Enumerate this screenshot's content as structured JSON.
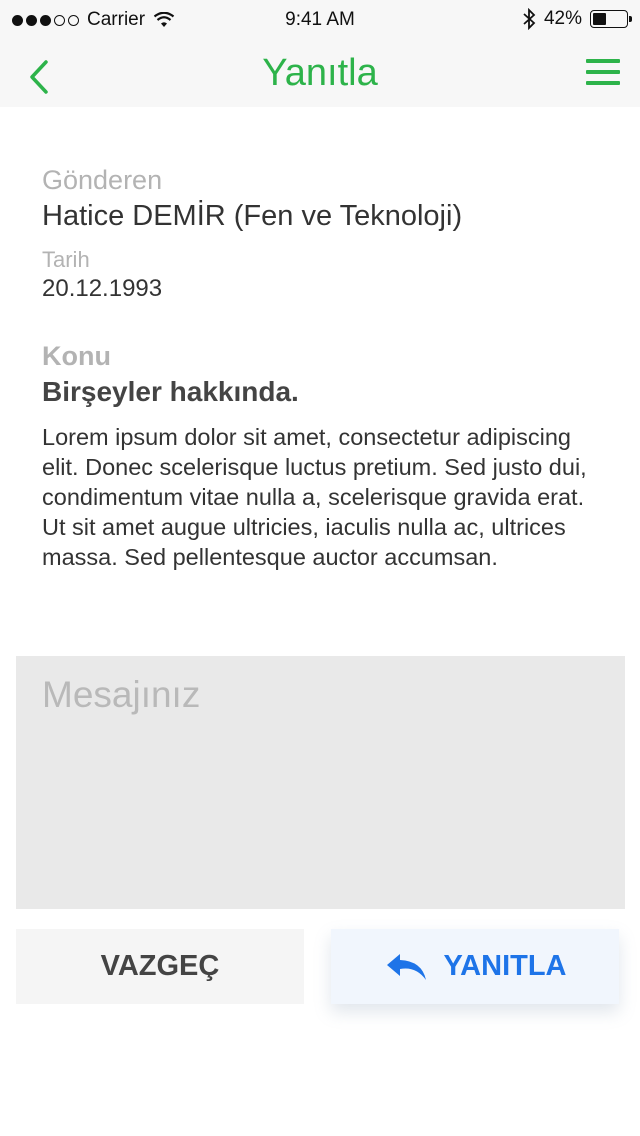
{
  "status_bar": {
    "carrier": "Carrier",
    "time": "9:41 AM",
    "battery": "42%",
    "battery_level": 0.42
  },
  "nav": {
    "title": "Yanıtla",
    "back_icon": "chevron-left-icon",
    "menu_icon": "hamburger-menu-icon"
  },
  "message": {
    "sender_label": "Gönderen",
    "sender": "Hatice DEMİR (Fen ve Teknoloji)",
    "date_label": "Tarih",
    "date": "20.12.1993",
    "subject_label": "Konu",
    "subject": "Birşeyler hakkında.",
    "body": "Lorem ipsum dolor sit amet, consectetur adipiscing elit. Donec scelerisque luctus pretium. Sed justo dui, condimentum vitae nulla a, scelerisque gravida erat. Ut sit amet augue ultricies, iaculis nulla ac, ultrices massa. Sed pellentesque auctor accumsan."
  },
  "reply": {
    "placeholder": "Mesajınız",
    "value": ""
  },
  "actions": {
    "cancel_label": "VAZGEÇ",
    "reply_label": "YANITLA",
    "reply_icon": "reply-arrow-icon"
  },
  "colors": {
    "accent_green": "#2db34a",
    "reply_blue": "#1e74e8"
  }
}
